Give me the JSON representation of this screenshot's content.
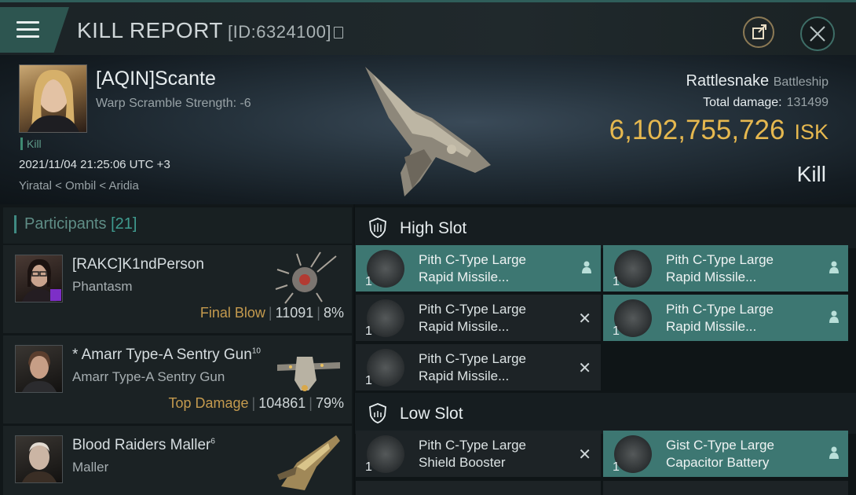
{
  "header": {
    "title": "KILL REPORT",
    "report_id": "[ID:6324100]"
  },
  "victim": {
    "name": "[AQIN]Scante",
    "scram": "Warp Scramble Strength: -6",
    "kill_tag": "Kill",
    "datetime": "2021/11/04 21:25:06 UTC +3",
    "location": "Yiratal < Ombil < Aridia",
    "ship_name": "Rattlesnake",
    "ship_class": "Battleship",
    "total_damage_label": "Total damage:",
    "total_damage": "131499",
    "isk_value": "6,102,755,726",
    "isk_currency": "ISK",
    "result": "Kill"
  },
  "participants": {
    "label": "Participants",
    "count": "[21]",
    "rows": [
      {
        "name": "[RAKC]K1ndPerson",
        "sup": "",
        "ship": "Phantasm",
        "tag": "Final Blow",
        "damage": "11091",
        "pct": "8%"
      },
      {
        "name": "* Amarr Type-A Sentry Gun",
        "sup": "10",
        "ship": "Amarr Type-A Sentry Gun",
        "tag": "Top Damage",
        "damage": "104861",
        "pct": "79%"
      },
      {
        "name": "Blood Raiders Maller",
        "sup": "6",
        "ship": "Maller",
        "tag": "",
        "damage": "",
        "pct": ""
      }
    ]
  },
  "slots": {
    "high": {
      "label": "High Slot",
      "modules": [
        {
          "qty": "1",
          "name1": "Pith C-Type Large",
          "name2": "Rapid Missile...",
          "state": "fitted"
        },
        {
          "qty": "1",
          "name1": "Pith C-Type Large",
          "name2": "Rapid Missile...",
          "state": "fitted"
        },
        {
          "qty": "1",
          "name1": "Pith C-Type Large",
          "name2": "Rapid Missile...",
          "state": "destroyed"
        },
        {
          "qty": "1",
          "name1": "Pith C-Type Large",
          "name2": "Rapid Missile...",
          "state": "fitted"
        },
        {
          "qty": "1",
          "name1": "Pith C-Type Large",
          "name2": "Rapid Missile...",
          "state": "destroyed"
        }
      ]
    },
    "low": {
      "label": "Low Slot",
      "modules": [
        {
          "qty": "1",
          "name1": "Pith C-Type Large",
          "name2": "Shield Booster",
          "state": "destroyed"
        },
        {
          "qty": "1",
          "name1": "Gist C-Type Large",
          "name2": "Capacitor Battery",
          "state": "fitted"
        }
      ]
    }
  },
  "colors": {
    "accent": "#3d7772",
    "isk": "#e6b84f",
    "tag": "#c49a4e"
  },
  "icons": [
    "menu-icon",
    "copy-icon",
    "external-link-icon",
    "close-icon",
    "shield-slot-icon",
    "pilot-icon",
    "destroyed-x-icon"
  ]
}
